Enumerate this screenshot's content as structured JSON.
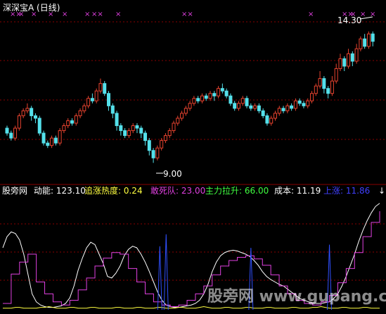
{
  "chart_data": [
    {
      "type": "candlestick",
      "title": "深深宝A (日线)",
      "ylim": [
        8.3,
        15.0
      ],
      "annotations": {
        "high_label": "14.30",
        "low_label": "9.00"
      },
      "colors": {
        "up": "#e8432f",
        "down": "#54e0ea",
        "grid": "#8a0000",
        "signal": "#e040e0",
        "title": "#ffffff"
      },
      "signal_marks": [
        "××",
        "×",
        "×",
        "×",
        "×",
        "×",
        "××",
        "×",
        "××",
        "×",
        "××",
        "×",
        "×",
        "×"
      ],
      "candles": [
        [
          10.4,
          10.2,
          10.5,
          10.1
        ],
        [
          10.2,
          10.0,
          10.3,
          9.9
        ],
        [
          10.0,
          10.4,
          10.5,
          9.9
        ],
        [
          10.4,
          10.9,
          11.0,
          10.3
        ],
        [
          10.9,
          11.1,
          11.2,
          10.8
        ],
        [
          11.1,
          11.2,
          11.4,
          11.0
        ],
        [
          11.2,
          10.9,
          11.3,
          10.7
        ],
        [
          10.9,
          10.8,
          11.0,
          10.6
        ],
        [
          10.8,
          10.2,
          10.9,
          10.1
        ],
        [
          10.2,
          9.8,
          10.3,
          9.7
        ],
        [
          9.8,
          9.7,
          9.9,
          9.6
        ],
        [
          9.7,
          10.0,
          10.1,
          9.6
        ],
        [
          10.0,
          9.8,
          10.1,
          9.7
        ],
        [
          9.8,
          10.3,
          10.4,
          9.7
        ],
        [
          10.3,
          10.5,
          10.6,
          10.2
        ],
        [
          10.5,
          10.7,
          10.8,
          10.4
        ],
        [
          10.7,
          10.6,
          10.8,
          10.5
        ],
        [
          10.6,
          10.9,
          11.0,
          10.5
        ],
        [
          10.9,
          11.1,
          11.2,
          10.8
        ],
        [
          11.1,
          11.3,
          11.4,
          11.0
        ],
        [
          11.3,
          11.6,
          11.7,
          11.2
        ],
        [
          11.6,
          11.5,
          11.8,
          11.4
        ],
        [
          11.5,
          11.9,
          12.0,
          11.4
        ],
        [
          11.9,
          12.2,
          12.4,
          11.8
        ],
        [
          12.2,
          11.8,
          12.3,
          11.7
        ],
        [
          11.8,
          11.3,
          11.9,
          11.1
        ],
        [
          11.3,
          11.0,
          11.4,
          10.8
        ],
        [
          11.0,
          10.5,
          11.1,
          10.3
        ],
        [
          10.5,
          10.3,
          10.6,
          10.1
        ],
        [
          10.3,
          10.1,
          10.4,
          10.0
        ],
        [
          10.1,
          10.3,
          10.4,
          10.0
        ],
        [
          10.3,
          10.5,
          10.6,
          10.2
        ],
        [
          10.5,
          10.4,
          10.6,
          10.2
        ],
        [
          10.4,
          10.2,
          10.5,
          10.0
        ],
        [
          10.2,
          9.9,
          10.3,
          9.7
        ],
        [
          9.9,
          9.5,
          10.0,
          9.3
        ],
        [
          9.5,
          9.2,
          9.6,
          9.0
        ],
        [
          9.2,
          9.6,
          9.7,
          9.1
        ],
        [
          9.6,
          9.9,
          10.0,
          9.5
        ],
        [
          9.9,
          10.1,
          10.2,
          9.8
        ],
        [
          10.1,
          10.3,
          10.4,
          10.0
        ],
        [
          10.3,
          10.6,
          10.7,
          10.2
        ],
        [
          10.6,
          10.8,
          10.9,
          10.5
        ],
        [
          10.8,
          11.0,
          11.1,
          10.7
        ],
        [
          11.0,
          11.2,
          11.3,
          10.9
        ],
        [
          11.2,
          11.4,
          11.5,
          11.1
        ],
        [
          11.4,
          11.6,
          11.7,
          11.3
        ],
        [
          11.6,
          11.5,
          11.7,
          11.4
        ],
        [
          11.5,
          11.7,
          11.8,
          11.4
        ],
        [
          11.7,
          11.6,
          11.8,
          11.5
        ],
        [
          11.6,
          11.8,
          11.9,
          11.5
        ],
        [
          11.8,
          11.7,
          11.9,
          11.5
        ],
        [
          11.7,
          12.0,
          12.1,
          11.6
        ],
        [
          12.0,
          11.9,
          12.2,
          11.8
        ],
        [
          11.9,
          11.7,
          12.0,
          11.6
        ],
        [
          11.7,
          11.4,
          11.8,
          11.3
        ],
        [
          11.4,
          11.2,
          11.5,
          11.1
        ],
        [
          11.2,
          11.4,
          11.5,
          11.1
        ],
        [
          11.4,
          11.6,
          11.7,
          11.3
        ],
        [
          11.6,
          11.3,
          11.7,
          11.2
        ],
        [
          11.3,
          11.2,
          11.4,
          11.1
        ],
        [
          11.2,
          11.3,
          11.4,
          11.1
        ],
        [
          11.3,
          11.1,
          11.4,
          11.0
        ],
        [
          11.1,
          10.9,
          11.2,
          10.8
        ],
        [
          10.9,
          10.6,
          11.0,
          10.5
        ],
        [
          10.6,
          10.8,
          10.9,
          10.5
        ],
        [
          10.8,
          11.0,
          11.1,
          10.7
        ],
        [
          11.0,
          11.2,
          11.3,
          10.9
        ],
        [
          11.2,
          11.1,
          11.3,
          11.0
        ],
        [
          11.1,
          11.3,
          11.4,
          11.0
        ],
        [
          11.3,
          11.2,
          11.4,
          11.1
        ],
        [
          11.2,
          11.5,
          11.6,
          11.1
        ],
        [
          11.5,
          11.4,
          11.6,
          11.3
        ],
        [
          11.4,
          11.3,
          11.5,
          11.2
        ],
        [
          11.3,
          11.5,
          11.6,
          11.2
        ],
        [
          11.5,
          11.8,
          11.9,
          11.4
        ],
        [
          11.8,
          12.1,
          12.2,
          11.7
        ],
        [
          12.1,
          12.4,
          12.7,
          12.0
        ],
        [
          12.4,
          12.0,
          12.5,
          11.8
        ],
        [
          12.0,
          11.8,
          12.1,
          11.6
        ],
        [
          11.8,
          12.3,
          12.5,
          11.7
        ],
        [
          12.3,
          12.8,
          13.0,
          12.2
        ],
        [
          12.8,
          13.2,
          13.4,
          12.7
        ],
        [
          13.2,
          12.9,
          13.3,
          12.7
        ],
        [
          12.9,
          13.4,
          13.6,
          12.8
        ],
        [
          13.4,
          13.1,
          13.5,
          12.9
        ],
        [
          13.1,
          13.6,
          13.8,
          13.0
        ],
        [
          13.6,
          14.0,
          14.1,
          13.5
        ],
        [
          14.0,
          13.7,
          14.2,
          13.6
        ],
        [
          13.7,
          14.2,
          14.3,
          13.6
        ],
        [
          14.2,
          13.9,
          14.3,
          13.7
        ]
      ]
    },
    {
      "type": "line",
      "labels": {
        "site": "股旁网",
        "dongneng": "动能: 123.10",
        "zhuizhang": "追涨热度: 0.24",
        "gansi": "敢死队: 23.00",
        "zhuli": "主力拉升: 66.00",
        "chengben": "成本: 11.19",
        "shangzhang": "上涨: 11.86",
        "arrow": "↓"
      },
      "label_colors": {
        "site": "#ffffff",
        "dongneng": "#ffffff",
        "zhuizhang": "#ffff40",
        "gansi": "#e040e0",
        "zhuli": "#40ff40",
        "chengben": "#ffffff",
        "shangzhang": "#4040ff"
      },
      "watermark": "股旁网 www.gupang.com",
      "ylim": [
        0,
        140
      ],
      "series": [
        {
          "color": "#ffffff",
          "values": [
            78,
            92,
            98,
            96,
            88,
            70,
            45,
            20,
            10,
            6,
            4,
            3,
            3,
            4,
            5,
            8,
            15,
            30,
            50,
            65,
            78,
            85,
            82,
            70,
            58,
            42,
            40,
            46,
            55,
            68,
            76,
            80,
            78,
            70,
            60,
            48,
            35,
            22,
            12,
            6,
            4,
            3,
            3,
            4,
            5,
            6,
            8,
            12,
            20,
            32,
            48,
            60,
            68,
            72,
            74,
            75,
            74,
            72,
            70,
            67,
            62,
            56,
            48,
            42,
            38,
            35,
            32,
            30,
            26,
            22,
            18,
            14,
            12,
            10,
            9,
            8,
            8,
            9,
            10,
            14,
            20,
            30,
            42,
            56,
            70,
            86,
            100,
            112,
            122,
            130,
            134
          ]
        },
        {
          "color": "#e040e0",
          "values": [
            8,
            8,
            45,
            45,
            60,
            60,
            70,
            70,
            35,
            35,
            20,
            20,
            10,
            10,
            6,
            6,
            12,
            12,
            25,
            25,
            40,
            40,
            55,
            55,
            65,
            65,
            72,
            72,
            70,
            70,
            52,
            52,
            35,
            35,
            20,
            20,
            10,
            10,
            6,
            6,
            4,
            4,
            6,
            6,
            12,
            12,
            20,
            20,
            30,
            30,
            44,
            44,
            55,
            55,
            62,
            62,
            66,
            66,
            68,
            68,
            64,
            64,
            56,
            56,
            44,
            44,
            30,
            30,
            20,
            20,
            12,
            12,
            8,
            8,
            6,
            6,
            10,
            10,
            18,
            18,
            34,
            34,
            52,
            52,
            72,
            72,
            92,
            92,
            110,
            110,
            124
          ]
        },
        {
          "color": "#ffff40",
          "values": [
            2,
            2,
            2,
            3,
            3,
            2,
            2,
            2,
            2,
            3,
            3,
            4,
            3,
            2,
            2,
            2,
            3,
            3,
            2,
            2,
            2,
            3,
            3,
            2,
            2,
            2,
            2,
            3,
            3,
            2,
            2,
            2,
            3,
            3,
            2,
            2,
            2,
            3,
            3,
            2,
            2,
            2,
            3,
            3,
            2,
            2,
            2,
            3,
            4,
            3,
            2,
            2,
            2,
            3,
            3,
            2,
            2,
            2,
            3,
            3,
            2,
            2,
            2,
            3,
            3,
            2,
            2,
            2,
            2,
            3,
            3,
            2,
            2,
            2,
            3,
            3,
            4,
            3,
            2,
            2,
            2,
            3,
            3,
            2,
            2,
            2,
            3,
            3,
            2,
            2,
            2
          ]
        },
        {
          "color": "#3050ff",
          "style": "spikes",
          "values": [
            0,
            0,
            0,
            0,
            0,
            0,
            0,
            0,
            0,
            0,
            0,
            0,
            0,
            0,
            0,
            0,
            0,
            0,
            0,
            0,
            0,
            0,
            0,
            0,
            0,
            0,
            0,
            0,
            0,
            0,
            0,
            0,
            0,
            0,
            0,
            0,
            0,
            0,
            0,
            0,
            0,
            0,
            0,
            0,
            0,
            0,
            0,
            0,
            0,
            0,
            0,
            0,
            0,
            0,
            0,
            0,
            0,
            0,
            80,
            0,
            0,
            0,
            0,
            0,
            0,
            0,
            0,
            0,
            0,
            0,
            0,
            0,
            0,
            0,
            0,
            0,
            0,
            0,
            0,
            0,
            0,
            0,
            0,
            0,
            0,
            0,
            0,
            0,
            0,
            0,
            0
          ]
        }
      ],
      "spikes": [
        [
          50,
          80
        ],
        [
          52,
          95
        ],
        [
          79,
          78
        ],
        [
          104,
          82
        ]
      ]
    }
  ]
}
